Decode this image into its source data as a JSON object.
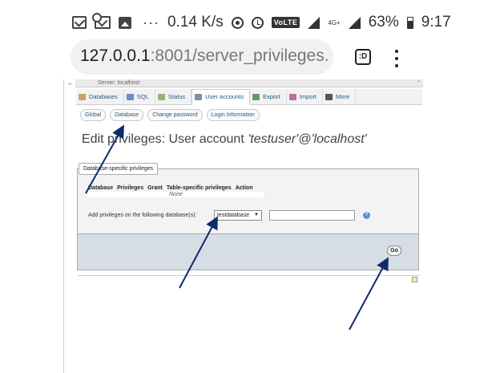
{
  "status_bar": {
    "speed": "0.14 K/s",
    "volte": "VoLTE",
    "network": "4G+",
    "battery": "63%",
    "time": "9:17",
    "overflow": "···"
  },
  "browser": {
    "url_host": "127.0.0.1",
    "url_rest": ":8001/server_privileges.",
    "tabs_label": ":D"
  },
  "pma": {
    "window_title": "Server: localhost",
    "top_menu": [
      {
        "label": "Databases",
        "icon": "databases-icon",
        "color": "#c8a46b"
      },
      {
        "label": "SQL",
        "icon": "sql-icon",
        "color": "#6d8fc1"
      },
      {
        "label": "Status",
        "icon": "status-icon",
        "color": "#9bb27a"
      },
      {
        "label": "User accounts",
        "icon": "users-icon",
        "color": "#7c90ad"
      },
      {
        "label": "Export",
        "icon": "export-icon",
        "color": "#5c9c5c"
      },
      {
        "label": "Import",
        "icon": "import-icon",
        "color": "#b86fa0"
      },
      {
        "label": "More",
        "icon": "chevron-down-icon",
        "color": "#555555"
      }
    ],
    "sub_tabs": [
      "Global",
      "Database",
      "Change password",
      "Login Information"
    ],
    "title_prefix": "Edit privileges: User account ",
    "title_user": "'testuser'@'localhost'",
    "legend": "Database-specific privileges",
    "table_headers": [
      "Database",
      "Privileges",
      "Grant",
      "Table-specific privileges",
      "Action"
    ],
    "table_none": "None",
    "add_label": "Add privileges on the following database(s):",
    "db_select_value": "testdatabase",
    "db_input_value": "",
    "help_glyph": "?",
    "go_label": "Go"
  },
  "annotation_color": "#0d2a6b"
}
